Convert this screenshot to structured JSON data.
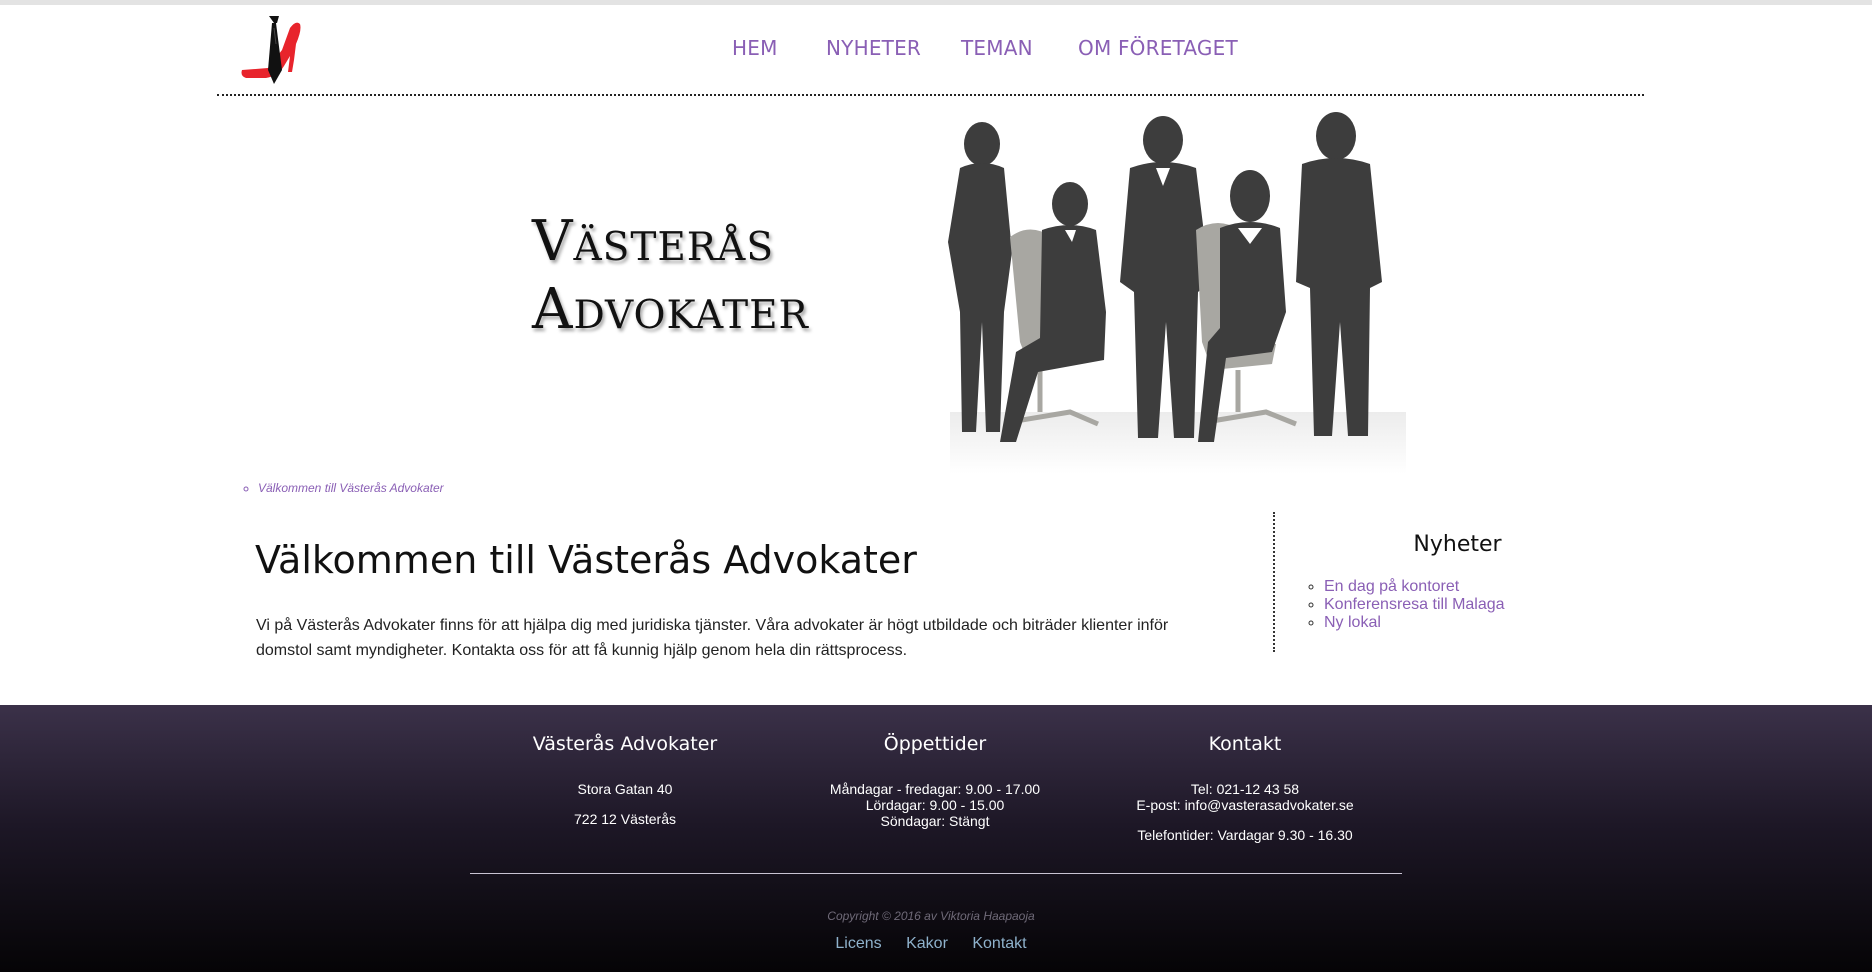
{
  "nav": {
    "items": [
      {
        "label": "HEM"
      },
      {
        "label": "NYHETER"
      },
      {
        "label": "TEMAN"
      },
      {
        "label": "OM FÖRETAGET"
      }
    ]
  },
  "hero": {
    "title_line1": "Västerås",
    "title_line2": "Advokater"
  },
  "breadcrumb": {
    "item": "Välkommen till Västerås Advokater"
  },
  "main": {
    "heading": "Välkommen till Västerås Advokater",
    "text": "Vi på Västerås Advokater finns för att hjälpa dig med juridiska tjänster. Våra advokater är högt utbildade och biträder klienter inför domstol samt myndigheter. Kontakta oss för att få kunnig hjälp genom hela din rättsprocess."
  },
  "sidebar": {
    "heading": "Nyheter",
    "items": [
      {
        "label": "En dag på kontoret"
      },
      {
        "label": "Konferensresa till Malaga"
      },
      {
        "label": "Ny lokal"
      }
    ]
  },
  "footer": {
    "company": {
      "heading": "Västerås Advokater",
      "street": "Stora Gatan 40",
      "city": "722 12 Västerås"
    },
    "hours": {
      "heading": "Öppettider",
      "weekdays": "Måndagar - fredagar: 9.00 - 17.00",
      "saturday": "Lördagar: 9.00 - 15.00",
      "sunday": "Söndagar: Stängt"
    },
    "contact": {
      "heading": "Kontakt",
      "phone": "Tel: 021-12 43 58",
      "email": "E-post: info@vasterasadvokater.se",
      "phone_hours": "Telefontider: Vardagar 9.30 - 16.30"
    },
    "copyright": "Copyright © 2016 av Viktoria Haapaoja",
    "links": [
      {
        "label": "Licens"
      },
      {
        "label": "Kakor"
      },
      {
        "label": "Kontakt"
      }
    ]
  },
  "colors": {
    "accent": "#8a5fb5",
    "footer_top": "#3b3149",
    "footer_bottom": "#050406",
    "link_footer": "#8fb2cc"
  },
  "icons": {
    "logo": "high-heel-and-tie-logo"
  }
}
